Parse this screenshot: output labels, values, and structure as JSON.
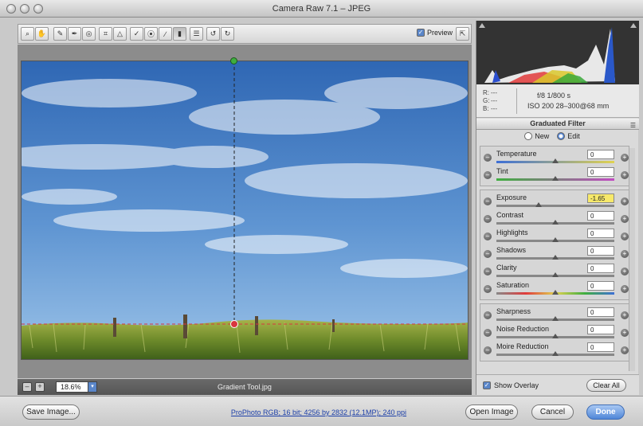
{
  "window": {
    "title": "Camera Raw 7.1  –  JPEG"
  },
  "toolbar": {
    "tools": [
      "zoom-icon",
      "hand-icon",
      "white-balance-icon",
      "color-sampler-icon",
      "targeted-adjust-icon",
      "crop-icon",
      "straighten-icon",
      "spot-removal-icon",
      "red-eye-icon",
      "adjustment-brush-icon",
      "graduated-filter-icon",
      "preferences-icon",
      "rotate-left-icon",
      "rotate-right-icon"
    ],
    "preview_label": "Preview",
    "preview_checked": true
  },
  "image": {
    "filename": "Gradient Tool.jpg",
    "zoom": "18.6%"
  },
  "info": {
    "r": "---",
    "g": "---",
    "b": "---",
    "aperture_shutter": "f/8   1/800 s",
    "iso_lens": "ISO 200   28–300@68 mm"
  },
  "panel": {
    "title": "Graduated Filter",
    "mode_new": "New",
    "mode_edit": "Edit",
    "mode_selected": "Edit",
    "groups": [
      [
        {
          "label": "Temperature",
          "value": "0",
          "pos": 0.5,
          "track": "linear-gradient(90deg,#3d6fd6,#e0d250)"
        },
        {
          "label": "Tint",
          "value": "0",
          "pos": 0.5,
          "track": "linear-gradient(90deg,#3fae3f,#c24bc2)"
        }
      ],
      [
        {
          "label": "Exposure",
          "value": "-1.65",
          "pos": 0.36,
          "highlight": true
        },
        {
          "label": "Contrast",
          "value": "0",
          "pos": 0.5
        },
        {
          "label": "Highlights",
          "value": "0",
          "pos": 0.5
        },
        {
          "label": "Shadows",
          "value": "0",
          "pos": 0.5
        },
        {
          "label": "Clarity",
          "value": "0",
          "pos": 0.5
        },
        {
          "label": "Saturation",
          "value": "0",
          "pos": 0.5,
          "track": "linear-gradient(90deg,#888,#e03b3b,#e0d250,#3fae3f,#3d6fd6)"
        }
      ],
      [
        {
          "label": "Sharpness",
          "value": "0",
          "pos": 0.5
        },
        {
          "label": "Noise Reduction",
          "value": "0",
          "pos": 0.5
        },
        {
          "label": "Moire Reduction",
          "value": "0",
          "pos": 0.5
        }
      ]
    ],
    "show_overlay_label": "Show Overlay",
    "show_overlay_checked": true,
    "clear_all_label": "Clear All"
  },
  "bottom": {
    "save_label": "Save Image...",
    "workflow_link": "ProPhoto RGB; 16 bit; 4256 by 2832 (12.1MP); 240 ppi",
    "open_label": "Open Image",
    "cancel_label": "Cancel",
    "done_label": "Done"
  },
  "colors": {
    "accent": "#4f86d8",
    "gradient_start_pin": "#3fae3f",
    "gradient_end_pin": "#d9363e",
    "highlight_field": "#f7e96a"
  }
}
